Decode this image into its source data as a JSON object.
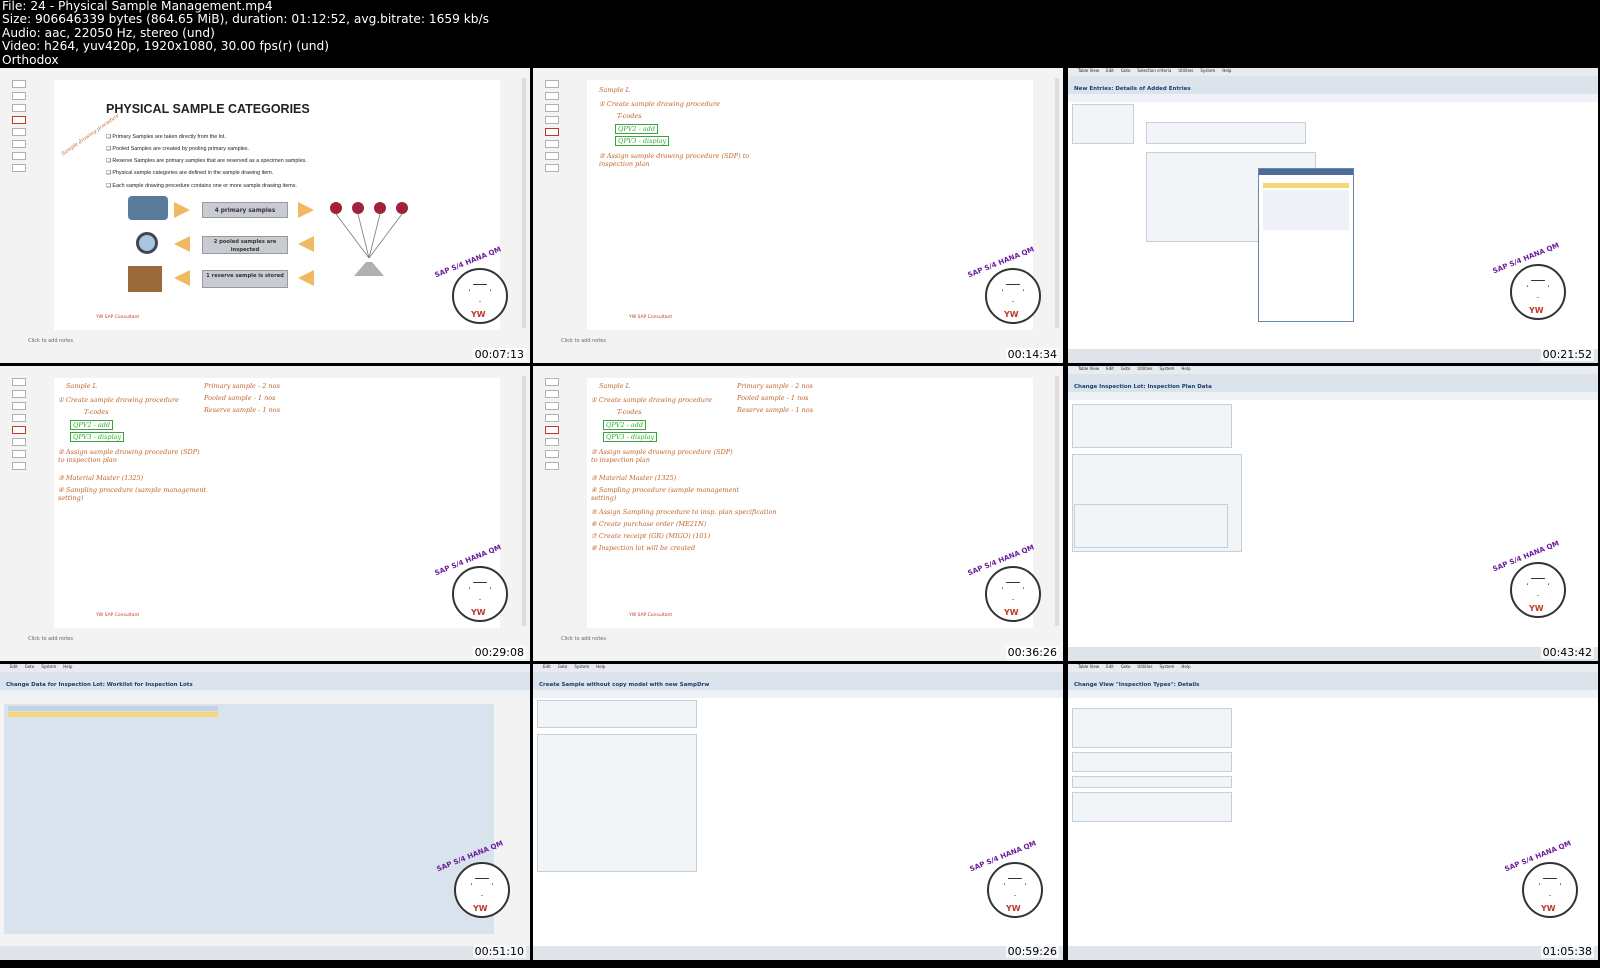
{
  "header": {
    "line1": "File: 24 - Physical Sample Management.mp4",
    "line2": "Size: 906646339 bytes (864.65 MiB), duration: 01:12:52, avg.bitrate: 1659 kb/s",
    "line3": "Audio: aac, 22050 Hz, stereo (und)",
    "line4": "Video: h264, yuv420p, 1920x1080, 30.00 fps(r) (und)",
    "line5": "Orthodox"
  },
  "thumbnails": [
    {
      "timestamp": "00:07:13"
    },
    {
      "timestamp": "00:14:34"
    },
    {
      "timestamp": "00:21:52"
    },
    {
      "timestamp": "00:29:08"
    },
    {
      "timestamp": "00:36:26"
    },
    {
      "timestamp": "00:43:42"
    },
    {
      "timestamp": "00:51:10"
    },
    {
      "timestamp": "00:59:26"
    },
    {
      "timestamp": "01:05:38"
    }
  ],
  "slide1": {
    "title": "PHYSICAL SAMPLE CATEGORIES",
    "bullets": [
      "Primary Samples are taken directly from the lot.",
      "Pooled Samples are created by pooling primary samples.",
      "Reserve Samples are primary samples that are reserved as a specimen samples.",
      "Physical sample categories are defined in the sample drawing item.",
      "Each sample drawing procedure contains one or more sample drawing items."
    ],
    "boxes": [
      "4 primary samples",
      "2 pooled samples are inspected",
      "1 reserve sample is stored"
    ],
    "footer": "YW SAP Consultant",
    "notes": "Click to add notes"
  },
  "handwriting": {
    "sample": "Sample L",
    "step1": "① Create sample drawing procedure",
    "tcode": "T-codes",
    "qpv2": "QPV2 - add",
    "qpv3": "QPV3 - display",
    "step2": "② Assign sample drawing procedure (SDP) to inspection plan",
    "step3": "③ Material Master (1325)",
    "step4": "④ Sampling procedure (sample management setting)",
    "step5": "⑤ Assign Sampling procedure to insp. plan specification",
    "step6": "⑥ Create purchase order (ME21N)",
    "step7": "⑦ Create receipt (GR) (MIGO) (101)",
    "step8": "⑧ Inspection lot will be created",
    "primary": "Primary sample - 2 nos",
    "pooled": "Pooled sample - 1 nos",
    "reserve": "Reserve sample - 1 nos"
  },
  "sap": {
    "menu": [
      "Table View",
      "Edit",
      "Goto",
      "Selection criteria",
      "Utilities",
      "System",
      "Help"
    ],
    "title_new_entries": "New Entries: Details of Added Entries",
    "title_insp_plan": "Change Inspection Lot: Inspection Plan Data",
    "title_worklist": "Change Data for Inspection Lot: Worklist for Inspection Lots",
    "title_create_sample": "Create Sample without copy model with new SampDrw",
    "title_insp_types": "Change View \"Inspection Types\": Details"
  },
  "logo": {
    "text": "SAP S/4 HANA QM",
    "mark": "YW"
  }
}
